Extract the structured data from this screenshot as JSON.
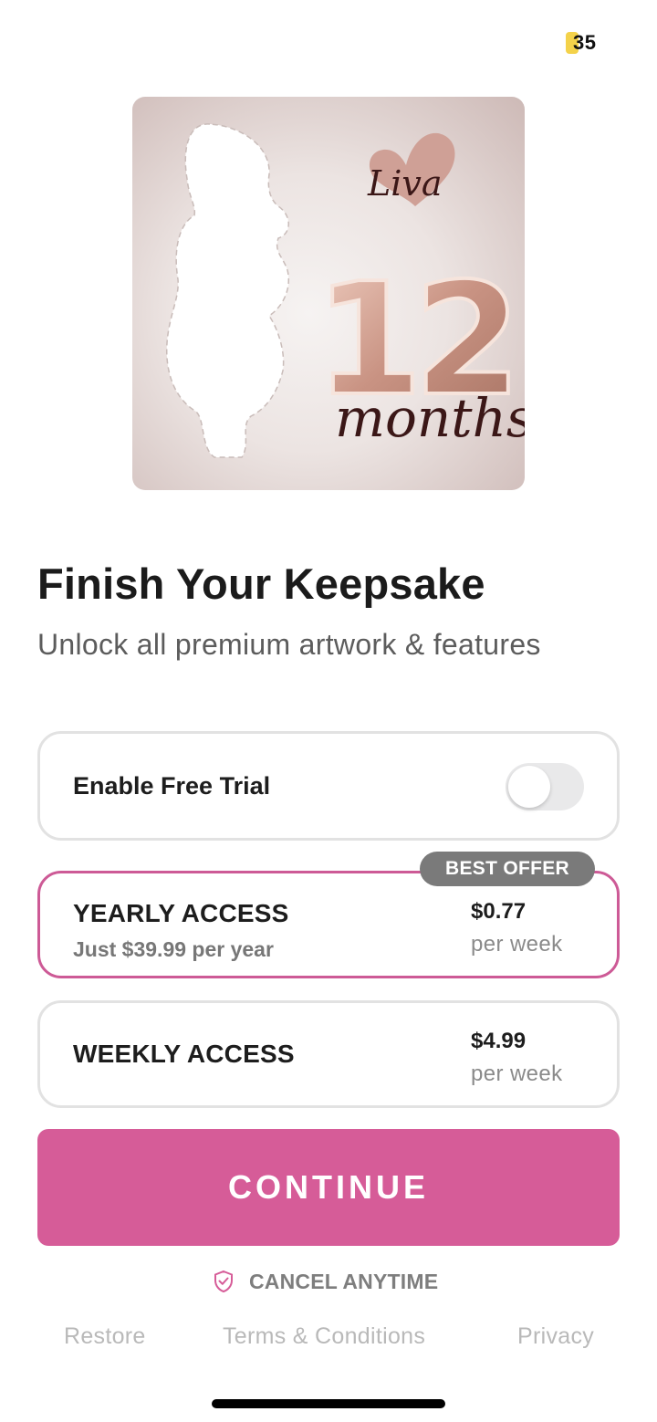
{
  "status": {
    "counter": "35"
  },
  "hero": {
    "name": "Liva",
    "number": "12",
    "unit": "months"
  },
  "header": {
    "title": "Finish Your Keepsake",
    "subtitle": "Unlock all premium artwork & features"
  },
  "trial": {
    "label": "Enable Free Trial",
    "enabled": false
  },
  "plans": [
    {
      "name": "YEARLY ACCESS",
      "sub": "Just $39.99 per year",
      "price": "$0.77",
      "period": "per week",
      "selected": true,
      "badge": "BEST OFFER"
    },
    {
      "name": "WEEKLY ACCESS",
      "sub": "",
      "price": "$4.99",
      "period": "per week",
      "selected": false
    }
  ],
  "cta": {
    "label": "CONTINUE"
  },
  "cancel": {
    "label": "CANCEL ANYTIME",
    "icon": "shield-check-icon"
  },
  "footer": {
    "restore": "Restore",
    "terms": "Terms & Conditions",
    "privacy": "Privacy"
  },
  "colors": {
    "accent": "#d65c98",
    "selected_border": "#cd5a96",
    "badge": "#7a7a7a",
    "balloon": "#d4a090"
  }
}
